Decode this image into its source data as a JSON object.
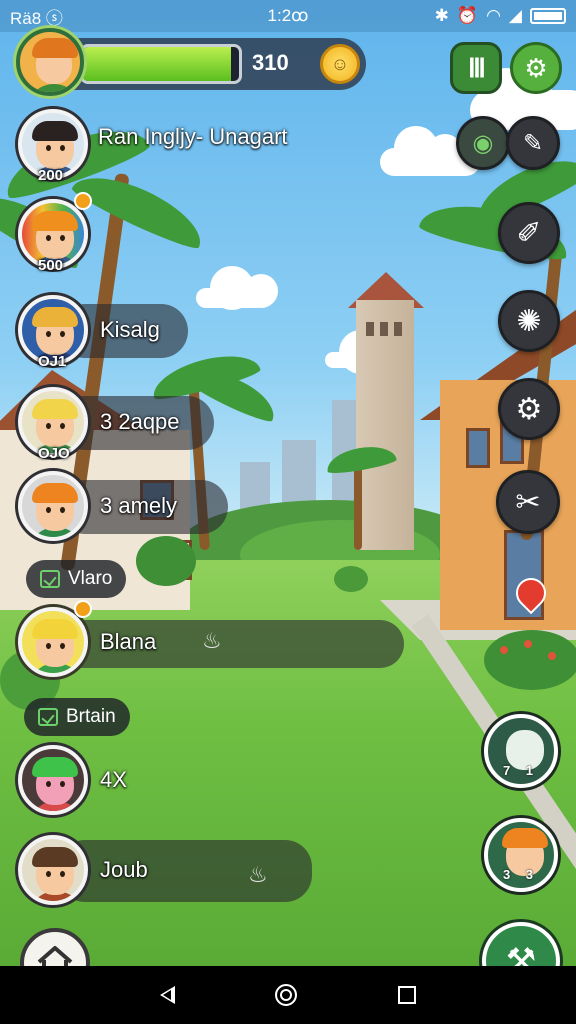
{
  "status_bar": {
    "left_text": "Rä8 ⓢ",
    "time": "1:2ꝏ"
  },
  "hud": {
    "score": "310",
    "health_fraction": 0.95,
    "menu_icon": "grid-columns-icon",
    "settings_icon": "gear-icon"
  },
  "friends": [
    {
      "name": "Ran Ingljy- Unagart",
      "level": "200"
    },
    {
      "name": "",
      "level": "500"
    },
    {
      "name": "Kisalg",
      "level": "OJ1"
    },
    {
      "name": "3 2aqpe",
      "level": "OJO"
    },
    {
      "name": "3 amely",
      "level": ""
    },
    {
      "name": "Blana",
      "level": ""
    },
    {
      "name": "4X",
      "level": ""
    },
    {
      "name": "Joub",
      "level": ""
    }
  ],
  "pills": {
    "first": "Vlaro",
    "second": "Brtain"
  },
  "right_avatars": [
    {
      "label": "7 1"
    },
    {
      "label": "3 3"
    }
  ],
  "side_buttons": [
    "map-pin-icon",
    "tools-icon",
    "pencil-icon",
    "lightbulb-icon",
    "gear-icon",
    "crossed-tools-icon"
  ],
  "colors": {
    "accent_green": "#56b03e",
    "health_green": "#7ad530"
  }
}
